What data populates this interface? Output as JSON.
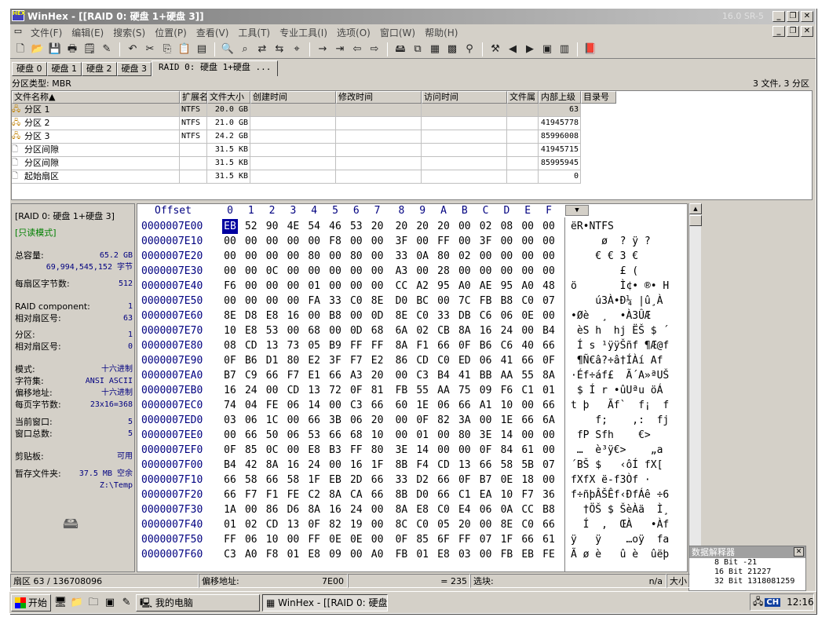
{
  "titlebar": {
    "title": "WinHex - [[RAID 0: 硬盘 1+硬盘 3]]",
    "version": "16.0 SR-5",
    "icon_text": "HEX"
  },
  "menu": [
    "文件(F)",
    "编辑(E)",
    "搜索(S)",
    "位置(P)",
    "查看(V)",
    "工具(T)",
    "专业工具(I)",
    "选项(O)",
    "窗口(W)",
    "帮助(H)"
  ],
  "tabs": [
    "硬盘 0",
    "硬盘 1",
    "硬盘 2",
    "硬盘 3",
    "RAID 0: 硬盘 1+硬盘 ..."
  ],
  "partition_bar": {
    "label": "分区类型: MBR",
    "summary": "3 文件, 3 分区"
  },
  "file_list": {
    "headers": [
      "文件名称▲",
      "扩展名",
      "文件大小",
      "创建时间",
      "修改时间",
      "访问时间",
      "文件属",
      "内部上级",
      "目录号"
    ],
    "rows": [
      {
        "name": "分区 1",
        "ext": "NTFS",
        "size": "20.0 GB",
        "sector": "63",
        "icon": "partition-icon"
      },
      {
        "name": "分区 2",
        "ext": "NTFS",
        "size": "21.0 GB",
        "sector": "41945778",
        "icon": "partition-icon"
      },
      {
        "name": "分区 3",
        "ext": "NTFS",
        "size": "24.2 GB",
        "sector": "85996008",
        "icon": "partition-icon"
      },
      {
        "name": "分区间隙",
        "ext": "",
        "size": "31.5 KB",
        "sector": "41945715",
        "icon": "file-icon"
      },
      {
        "name": "分区间隙",
        "ext": "",
        "size": "31.5 KB",
        "sector": "85995945",
        "icon": "file-icon"
      },
      {
        "name": "起始扇区",
        "ext": "",
        "size": "31.5 KB",
        "sector": "0",
        "icon": "file-icon"
      }
    ]
  },
  "info": {
    "drive_name": "[RAID 0: 硬盘 1+硬盘 3]",
    "mode": "[只读模式]",
    "capacity_label": "总容量:",
    "capacity_value": "65.2 GB",
    "capacity_bytes": "69,994,545,152 字节",
    "bytes_per_sector_label": "每扇区字节数:",
    "bytes_per_sector": "512",
    "raid_component_label": "RAID component:",
    "raid_component": "1",
    "rel_sector_label": "相对扇区号:",
    "rel_sector": "63",
    "partition_label": "分区:",
    "partition": "1",
    "rel_sector2_label": "相对扇区号:",
    "rel_sector2": "0",
    "mode_label": "模式:",
    "mode_value": "十六进制",
    "charset_label": "字符集:",
    "charset_value": "ANSI ASCII",
    "offset_label": "偏移地址:",
    "offset_value": "十六进制",
    "bytes_page_label": "每页字节数:",
    "bytes_page_value": "23x16=368",
    "cur_window_label": "当前窗口:",
    "cur_window": "5",
    "total_window_label": "窗口总数:",
    "total_window": "5",
    "clipboard_label": "剪贴板:",
    "clipboard_value": "可用",
    "temp_label": "暂存文件夹:",
    "temp_value": "37.5 MB 空余",
    "temp_path": "Z:\\Temp"
  },
  "hex": {
    "offset_label": "Offset",
    "columns": [
      "0",
      "1",
      "2",
      "3",
      "4",
      "5",
      "6",
      "7",
      "8",
      "9",
      "A",
      "B",
      "C",
      "D",
      "E",
      "F"
    ],
    "rows": [
      {
        "addr": "0000007E00",
        "bytes": [
          "EB",
          "52",
          "90",
          "4E",
          "54",
          "46",
          "53",
          "20",
          "20",
          "20",
          "20",
          "00",
          "02",
          "08",
          "00",
          "00"
        ],
        "ascii": "ëR•NTFS"
      },
      {
        "addr": "0000007E10",
        "bytes": [
          "00",
          "00",
          "00",
          "00",
          "00",
          "F8",
          "00",
          "00",
          "3F",
          "00",
          "FF",
          "00",
          "3F",
          "00",
          "00",
          "00"
        ],
        "ascii": "     ø  ? ÿ ?"
      },
      {
        "addr": "0000007E20",
        "bytes": [
          "00",
          "00",
          "00",
          "00",
          "80",
          "00",
          "80",
          "00",
          "33",
          "0A",
          "80",
          "02",
          "00",
          "00",
          "00",
          "00"
        ],
        "ascii": "    € € 3 €"
      },
      {
        "addr": "0000007E30",
        "bytes": [
          "00",
          "00",
          "0C",
          "00",
          "00",
          "00",
          "00",
          "00",
          "A3",
          "00",
          "28",
          "00",
          "00",
          "00",
          "00",
          "00"
        ],
        "ascii": "        £ ("
      },
      {
        "addr": "0000007E40",
        "bytes": [
          "F6",
          "00",
          "00",
          "00",
          "01",
          "00",
          "00",
          "00",
          "CC",
          "A2",
          "95",
          "A0",
          "AE",
          "95",
          "A0",
          "48"
        ],
        "ascii": "ö       Ì¢• ®• H"
      },
      {
        "addr": "0000007E50",
        "bytes": [
          "00",
          "00",
          "00",
          "00",
          "FA",
          "33",
          "C0",
          "8E",
          "D0",
          "BC",
          "00",
          "7C",
          "FB",
          "B8",
          "C0",
          "07"
        ],
        "ascii": "    ú3À•Ð¼ |û¸À"
      },
      {
        "addr": "0000007E60",
        "bytes": [
          "8E",
          "D8",
          "E8",
          "16",
          "00",
          "B8",
          "00",
          "0D",
          "8E",
          "C0",
          "33",
          "DB",
          "C6",
          "06",
          "0E",
          "00"
        ],
        "ascii": "•Øè  ¸  •À3ÛÆ"
      },
      {
        "addr": "0000007E70",
        "bytes": [
          "10",
          "E8",
          "53",
          "00",
          "68",
          "00",
          "0D",
          "68",
          "6A",
          "02",
          "CB",
          "8A",
          "16",
          "24",
          "00",
          "B4"
        ],
        "ascii": " èS h  hj ËŠ $ ´"
      },
      {
        "addr": "0000007E80",
        "bytes": [
          "08",
          "CD",
          "13",
          "73",
          "05",
          "B9",
          "FF",
          "FF",
          "8A",
          "F1",
          "66",
          "0F",
          "B6",
          "C6",
          "40",
          "66"
        ],
        "ascii": " Í s ¹ÿÿŠñf ¶Æ@f"
      },
      {
        "addr": "0000007E90",
        "bytes": [
          "0F",
          "B6",
          "D1",
          "80",
          "E2",
          "3F",
          "F7",
          "E2",
          "86",
          "CD",
          "C0",
          "ED",
          "06",
          "41",
          "66",
          "0F"
        ],
        "ascii": " ¶Ñ€â?÷â†ÍÀí Af"
      },
      {
        "addr": "0000007EA0",
        "bytes": [
          "B7",
          "C9",
          "66",
          "F7",
          "E1",
          "66",
          "A3",
          "20",
          "00",
          "C3",
          "B4",
          "41",
          "BB",
          "AA",
          "55",
          "8A"
        ],
        "ascii": "·Éf÷áf£  Ã´A»ªUŠ"
      },
      {
        "addr": "0000007EB0",
        "bytes": [
          "16",
          "24",
          "00",
          "CD",
          "13",
          "72",
          "0F",
          "81",
          "FB",
          "55",
          "AA",
          "75",
          "09",
          "F6",
          "C1",
          "01"
        ],
        "ascii": " $ Í r •ûUªu öÁ"
      },
      {
        "addr": "0000007EC0",
        "bytes": [
          "74",
          "04",
          "FE",
          "06",
          "14",
          "00",
          "C3",
          "66",
          "60",
          "1E",
          "06",
          "66",
          "A1",
          "10",
          "00",
          "66"
        ],
        "ascii": "t þ   Ãf`  f¡  f"
      },
      {
        "addr": "0000007ED0",
        "bytes": [
          "03",
          "06",
          "1C",
          "00",
          "66",
          "3B",
          "06",
          "20",
          "00",
          "0F",
          "82",
          "3A",
          "00",
          "1E",
          "66",
          "6A"
        ],
        "ascii": "    f;    ‚:  fj"
      },
      {
        "addr": "0000007EE0",
        "bytes": [
          "00",
          "66",
          "50",
          "06",
          "53",
          "66",
          "68",
          "10",
          "00",
          "01",
          "00",
          "80",
          "3E",
          "14",
          "00",
          "00"
        ],
        "ascii": " fP Sfh    €>"
      },
      {
        "addr": "0000007EF0",
        "bytes": [
          "0F",
          "85",
          "0C",
          "00",
          "E8",
          "B3",
          "FF",
          "80",
          "3E",
          "14",
          "00",
          "00",
          "0F",
          "84",
          "61",
          "00"
        ],
        "ascii": " …  è³ÿ€>    „a"
      },
      {
        "addr": "0000007F00",
        "bytes": [
          "B4",
          "42",
          "8A",
          "16",
          "24",
          "00",
          "16",
          "1F",
          "8B",
          "F4",
          "CD",
          "13",
          "66",
          "58",
          "5B",
          "07"
        ],
        "ascii": "´BŠ $   ‹ôÍ fX["
      },
      {
        "addr": "0000007F10",
        "bytes": [
          "66",
          "58",
          "66",
          "58",
          "1F",
          "EB",
          "2D",
          "66",
          "33",
          "D2",
          "66",
          "0F",
          "B7",
          "0E",
          "18",
          "00"
        ],
        "ascii": "fXfX ë-f3Òf ·"
      },
      {
        "addr": "0000007F20",
        "bytes": [
          "66",
          "F7",
          "F1",
          "FE",
          "C2",
          "8A",
          "CA",
          "66",
          "8B",
          "D0",
          "66",
          "C1",
          "EA",
          "10",
          "F7",
          "36"
        ],
        "ascii": "f÷ñþÂŠÊf‹ÐfÁê ÷6"
      },
      {
        "addr": "0000007F30",
        "bytes": [
          "1A",
          "00",
          "86",
          "D6",
          "8A",
          "16",
          "24",
          "00",
          "8A",
          "E8",
          "C0",
          "E4",
          "06",
          "0A",
          "CC",
          "B8"
        ],
        "ascii": "  †ÖŠ $ ŠèÀä  Ì¸"
      },
      {
        "addr": "0000007F40",
        "bytes": [
          "01",
          "02",
          "CD",
          "13",
          "0F",
          "82",
          "19",
          "00",
          "8C",
          "C0",
          "05",
          "20",
          "00",
          "8E",
          "C0",
          "66"
        ],
        "ascii": "  Í  ‚  ŒÀ   •Àf"
      },
      {
        "addr": "0000007F50",
        "bytes": [
          "FF",
          "06",
          "10",
          "00",
          "FF",
          "0E",
          "0E",
          "00",
          "0F",
          "85",
          "6F",
          "FF",
          "07",
          "1F",
          "66",
          "61"
        ],
        "ascii": "ÿ   ÿ    …oÿ  fa"
      },
      {
        "addr": "0000007F60",
        "bytes": [
          "C3",
          "A0",
          "F8",
          "01",
          "E8",
          "09",
          "00",
          "A0",
          "FB",
          "01",
          "E8",
          "03",
          "00",
          "FB",
          "EB",
          "FE"
        ],
        "ascii": "Ã ø è   û è  ûëþ"
      }
    ]
  },
  "interpreter": {
    "title": "数据解释器",
    "lines": [
      "8 Bit -21",
      "16 Bit 21227",
      "32 Bit 1318081259"
    ]
  },
  "status": {
    "sector": "扇区 63 / 136708096",
    "offset_label": "偏移地址:",
    "offset": "7E00",
    "value": "= 235",
    "block_label": "选块:",
    "na": "n/a",
    "size_label": "大小"
  },
  "taskbar": {
    "start": "开始",
    "tasks": [
      "我的电脑",
      "WinHex - [[RAID 0: 硬盘..."
    ],
    "ime": "CH",
    "clock": "12:16"
  }
}
